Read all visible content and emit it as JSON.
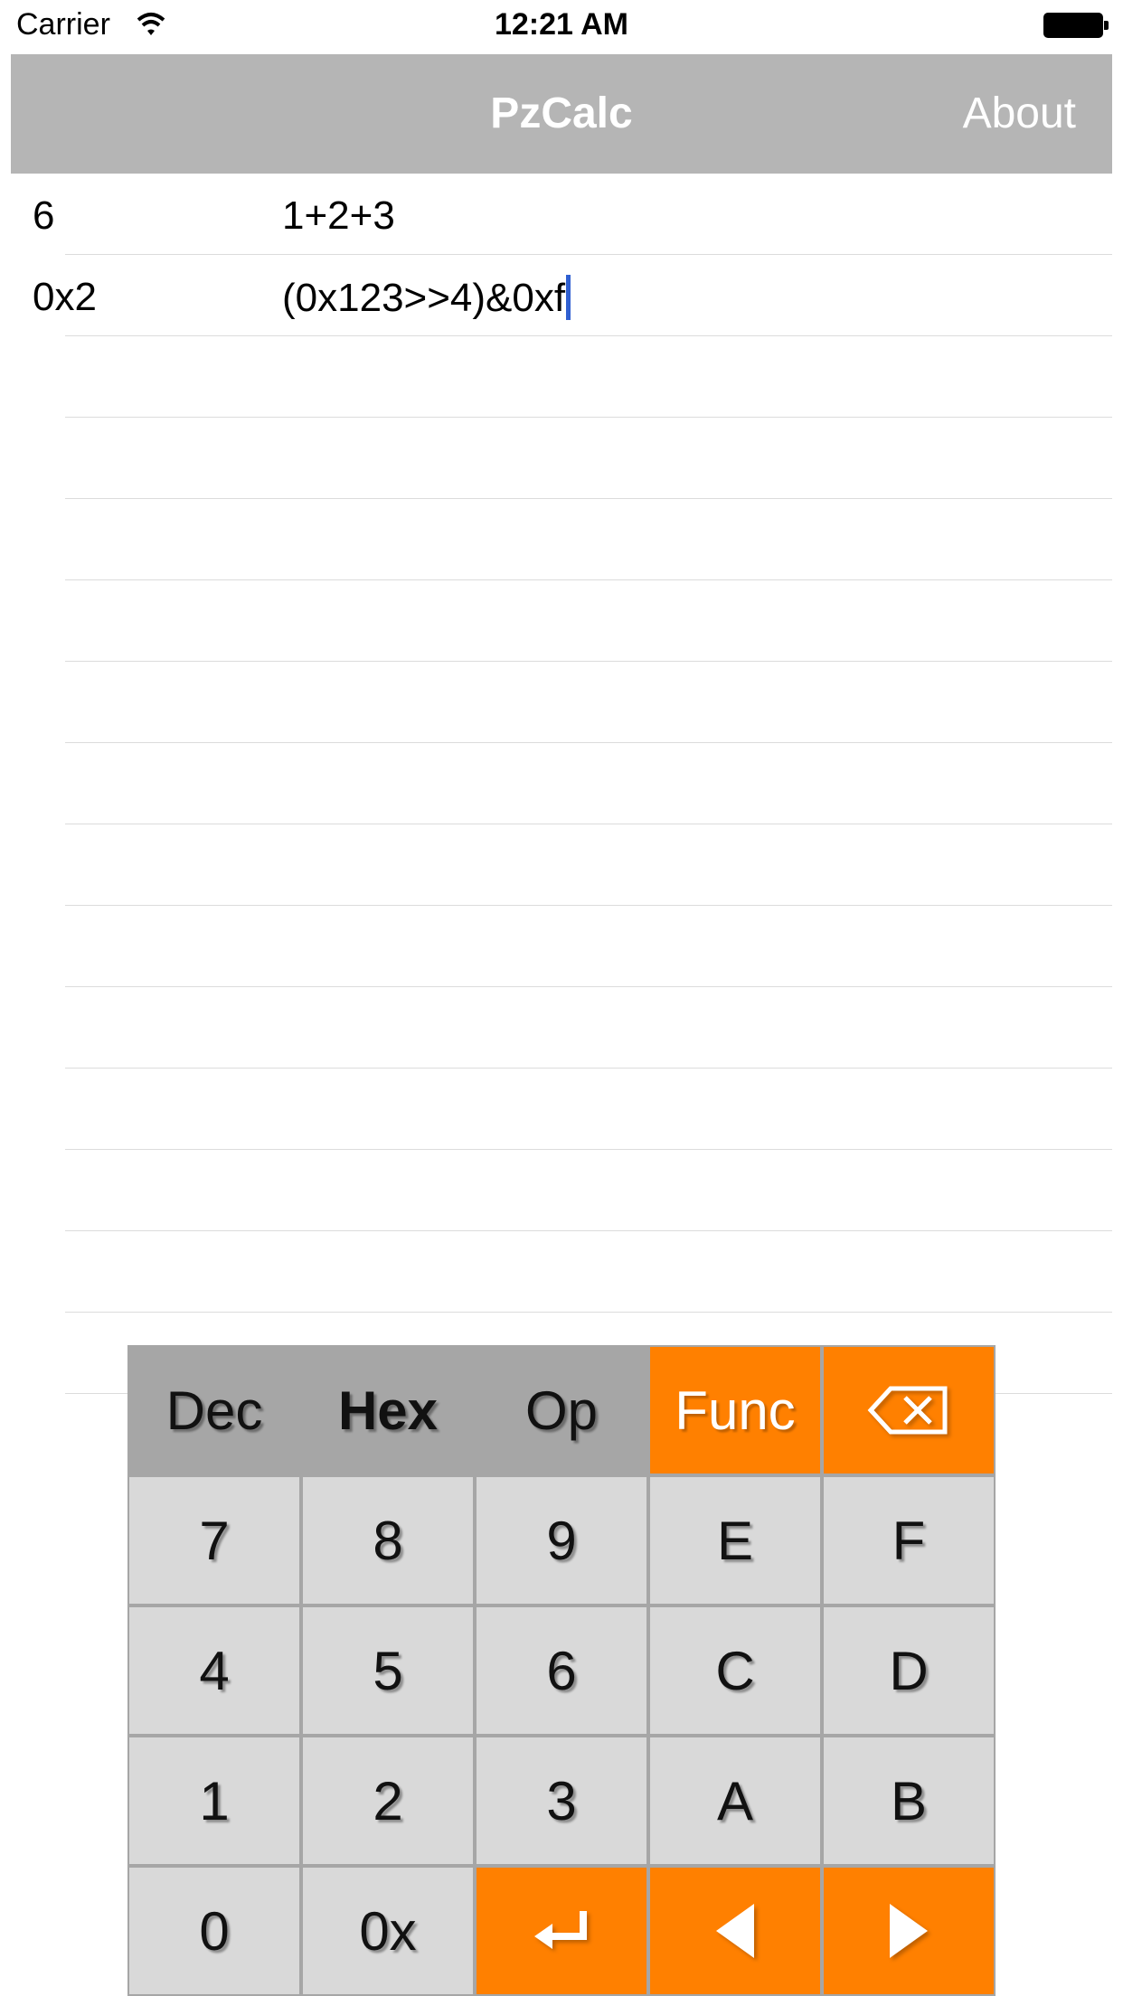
{
  "status_bar": {
    "carrier": "Carrier",
    "time": "12:21 AM"
  },
  "nav": {
    "title": "PzCalc",
    "about_label": "About"
  },
  "rows": [
    {
      "result": "6",
      "expression": "1+2+3"
    },
    {
      "result": "0x2",
      "expression": "(0x123>>4)&0xf"
    }
  ],
  "keypad": {
    "modes": {
      "dec": "Dec",
      "hex": "Hex",
      "op": "Op",
      "func": "Func",
      "backspace_icon": "backspace-icon"
    },
    "keys": {
      "k7": "7",
      "k8": "8",
      "k9": "9",
      "kE": "E",
      "kF": "F",
      "k4": "4",
      "k5": "5",
      "k6": "6",
      "kC": "C",
      "kD": "D",
      "k1": "1",
      "k2": "2",
      "k3": "3",
      "kA": "A",
      "kB": "B",
      "k0": "0",
      "k0x": "0x"
    },
    "active_mode": "Hex",
    "icons": {
      "enter": "enter-icon",
      "left": "left-arrow-icon",
      "right": "right-arrow-icon"
    }
  },
  "colors": {
    "nav_bg": "#b5b5b5",
    "accent": "#ff8000",
    "key_bg": "#d9d9d9",
    "mode_bg": "#a6a6a6",
    "caret": "#2f5fd1"
  }
}
